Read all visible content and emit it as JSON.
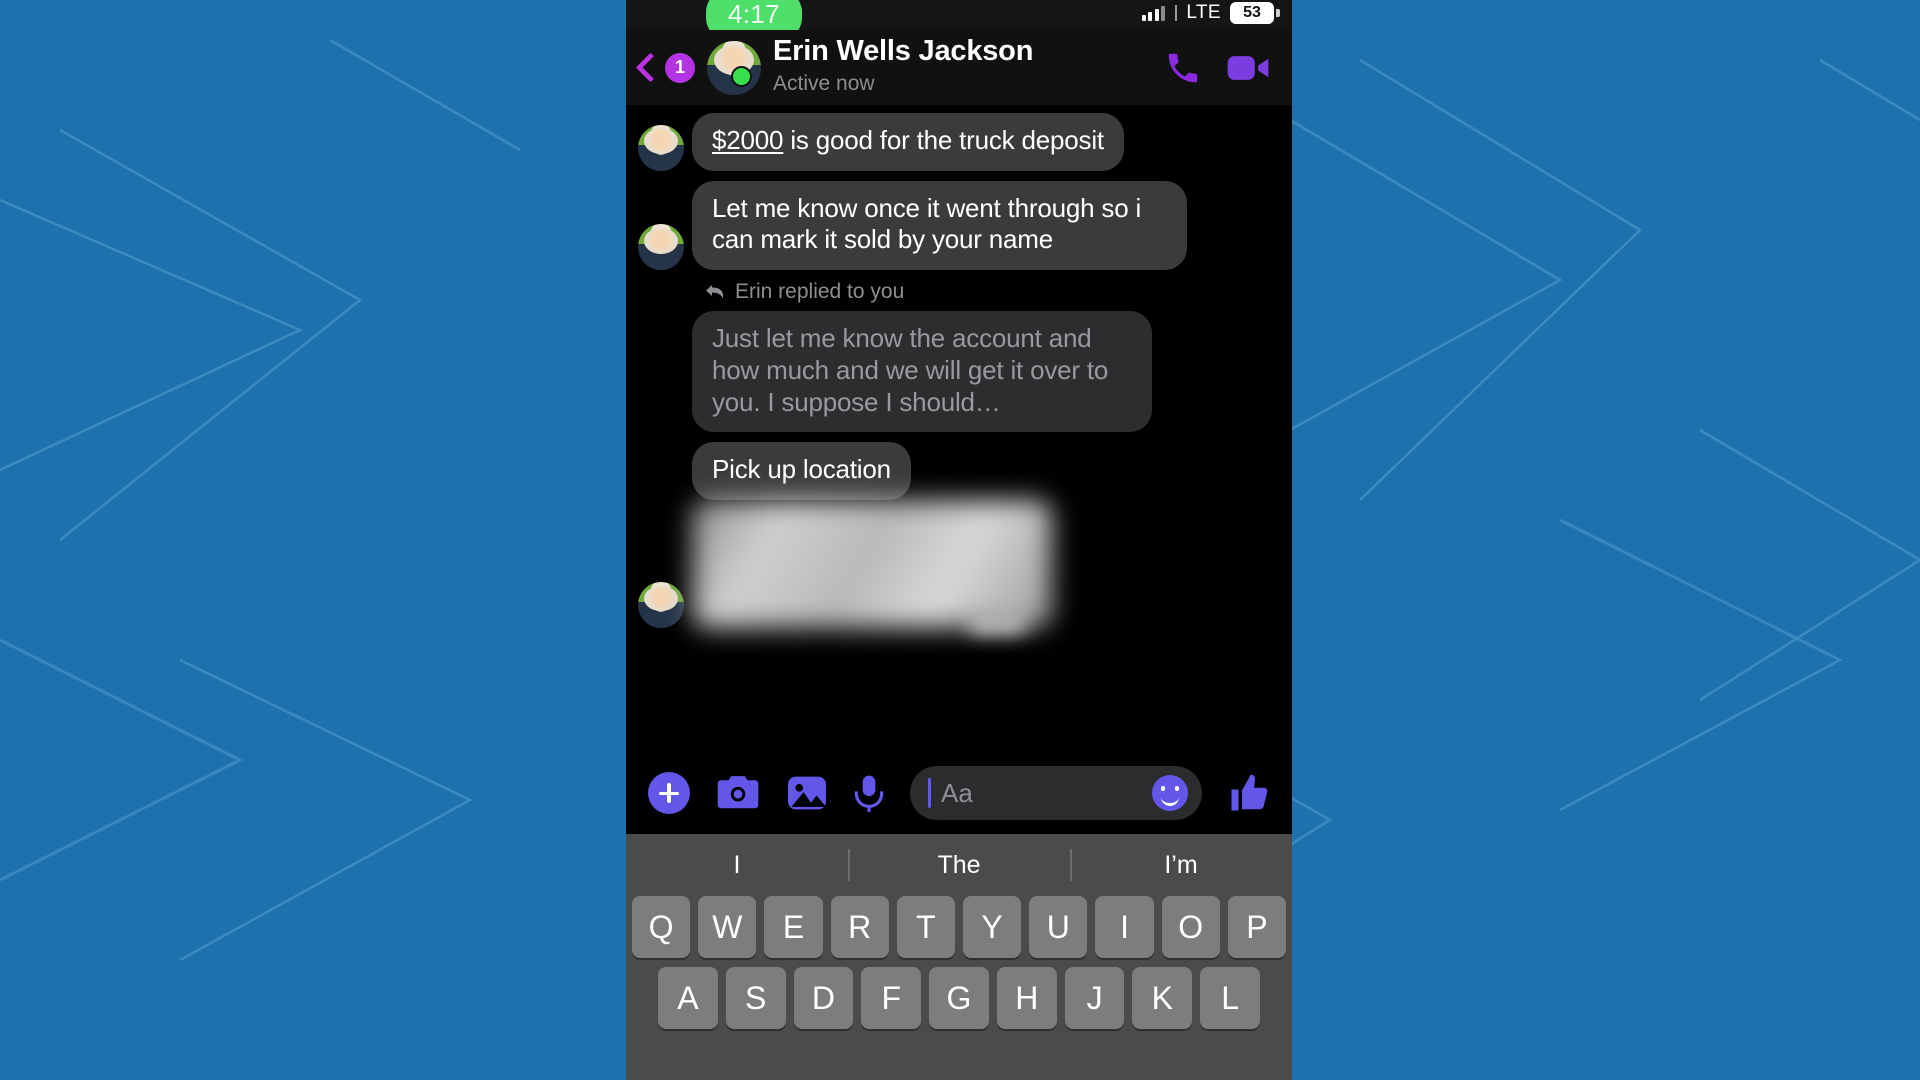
{
  "backdrop": {
    "color": "#1d72ad",
    "line_color": "#5ba0cc"
  },
  "status_bar": {
    "time": "4:17",
    "network_label": "LTE",
    "battery_level": "53",
    "signal_icon": "signal-bars-icon"
  },
  "chat_header": {
    "back_icon": "chevron-left-icon",
    "unread_count": "1",
    "avatar_icon": "contact-avatar",
    "presence_icon": "online-status-dot",
    "name": "Erin Wells Jackson",
    "status": "Active now",
    "call_icon": "phone-call-icon",
    "video_icon": "video-camera-icon"
  },
  "messages": [
    {
      "id": "msg-amount",
      "avatar": "contact-avatar",
      "link_text": "$2000",
      "text": " is good for the truck deposit",
      "style": "normal"
    },
    {
      "id": "msg-confirm",
      "avatar": "contact-avatar",
      "text": "Let me know once it went through so i can mark it sold by your name",
      "style": "normal"
    },
    {
      "id": "msg-quoted",
      "reply_label": "Erin replied to you",
      "reply_icon": "reply-arrow-icon",
      "text": "Just let me know the account and how much and we will get it over to you. I suppose I should…",
      "style": "quoted"
    },
    {
      "id": "msg-pickup",
      "avatar": "contact-avatar",
      "text": "Pick up location",
      "style": "normal"
    },
    {
      "id": "msg-attachment",
      "attachment_icon": "blurred-photo-attachment",
      "text": "",
      "style": "attachment"
    }
  ],
  "composer": {
    "add_icon": "plus-circle-icon",
    "camera_icon": "camera-icon",
    "gallery_icon": "photo-gallery-icon",
    "mic_icon": "microphone-icon",
    "input_placeholder": "Aa",
    "input_value": "",
    "emoji_icon": "emoji-smiley-icon",
    "like_icon": "thumbs-up-icon",
    "accent_color": "#6257e8"
  },
  "keyboard": {
    "suggestions": [
      "I",
      "The",
      "I’m"
    ],
    "rows": [
      [
        "Q",
        "W",
        "E",
        "R",
        "T",
        "Y",
        "U",
        "I",
        "O",
        "P"
      ],
      [
        "A",
        "S",
        "D",
        "F",
        "G",
        "H",
        "J",
        "K",
        "L"
      ]
    ]
  }
}
